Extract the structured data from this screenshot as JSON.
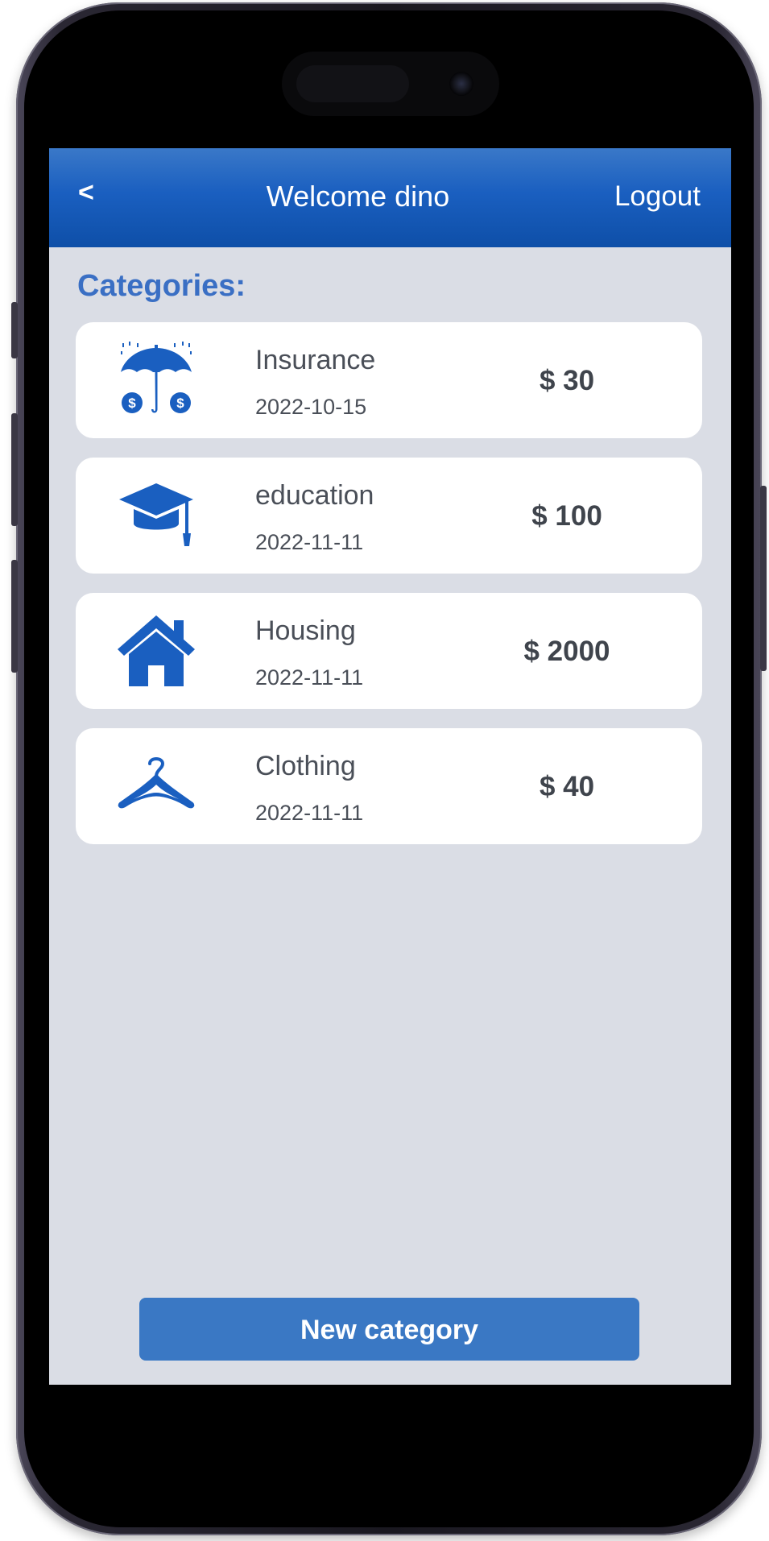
{
  "header": {
    "back_label": "<",
    "title": "Welcome dino",
    "logout_label": "Logout"
  },
  "section_label": "Categories:",
  "categories": [
    {
      "name": "Insurance",
      "date": "2022-10-15",
      "amount": "$ 30",
      "icon": "umbrella-money-icon"
    },
    {
      "name": "education",
      "date": "2022-11-11",
      "amount": "$ 100",
      "icon": "graduation-cap-icon"
    },
    {
      "name": "Housing",
      "date": "2022-11-11",
      "amount": "$ 2000",
      "icon": "house-icon"
    },
    {
      "name": "Clothing",
      "date": "2022-11-11",
      "amount": "$ 40",
      "icon": "hanger-icon"
    }
  ],
  "new_category_label": "New category",
  "colors": {
    "header_start": "#3a78c8",
    "header_end": "#0e4fa8",
    "accent": "#3a78c4",
    "icon": "#1a5fc0",
    "background": "#dadde5",
    "card": "#ffffff",
    "text": "#4a4f58"
  }
}
